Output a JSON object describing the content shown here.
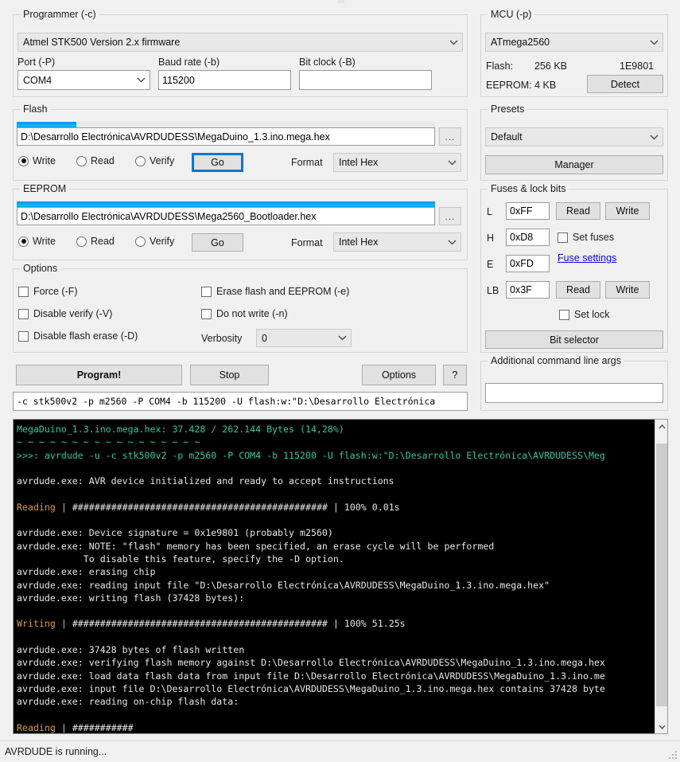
{
  "programmer": {
    "title": "Programmer (-c)",
    "selected": "Atmel STK500 Version 2.x firmware",
    "port_label": "Port (-P)",
    "port_value": "COM4",
    "baud_label": "Baud rate (-b)",
    "baud_value": "115200",
    "bitclock_label": "Bit clock (-B)",
    "bitclock_value": ""
  },
  "mcu": {
    "title": "MCU (-p)",
    "selected": "ATmega2560",
    "flash_label": "Flash:",
    "flash_value": "256 KB",
    "signature": "1E9801",
    "eeprom_label": "EEPROM: 4 KB",
    "detect_button": "Detect"
  },
  "flash": {
    "title": "Flash",
    "path": "D:\\Desarrollo Electrónica\\AVRDUDESS\\MegaDuino_1.3.ino.mega.hex",
    "browse": "...",
    "write": "Write",
    "read": "Read",
    "verify": "Verify",
    "go": "Go",
    "format_label": "Format",
    "format_value": "Intel Hex",
    "progress_percent": 14.28
  },
  "eeprom": {
    "title": "EEPROM",
    "path": "D:\\Desarrollo Electrónica\\AVRDUDESS\\Mega2560_Bootloader.hex",
    "browse": "...",
    "write": "Write",
    "read": "Read",
    "verify": "Verify",
    "go": "Go",
    "format_label": "Format",
    "format_value": "Intel Hex",
    "progress_percent": 100
  },
  "options": {
    "title": "Options",
    "force": "Force (-F)",
    "disable_verify": "Disable verify (-V)",
    "disable_flash_erase": "Disable flash erase (-D)",
    "erase_flash_eeprom": "Erase flash and EEPROM (-e)",
    "do_not_write": "Do not write (-n)",
    "verbosity_label": "Verbosity",
    "verbosity_value": "0"
  },
  "presets": {
    "title": "Presets",
    "selected": "Default",
    "manager_button": "Manager"
  },
  "fuses": {
    "title": "Fuses & lock bits",
    "l_label": "L",
    "l_value": "0xFF",
    "h_label": "H",
    "h_value": "0xD8",
    "e_label": "E",
    "e_value": "0xFD",
    "lb_label": "LB",
    "lb_value": "0x3F",
    "read_button": "Read",
    "write_button": "Write",
    "set_fuses": "Set fuses",
    "fuse_settings_link": "Fuse settings",
    "lb_read_button": "Read",
    "lb_write_button": "Write",
    "set_lock": "Set lock",
    "bit_selector_button": "Bit selector"
  },
  "actions": {
    "program": "Program!",
    "stop": "Stop",
    "options": "Options",
    "help": "?",
    "command_line": "-c stk500v2 -p m2560 -P COM4 -b 115200 -U flash:w:\"D:\\Desarrollo Electrónica"
  },
  "extra_args": {
    "title": "Additional command line args",
    "value": ""
  },
  "console": {
    "lines": [
      {
        "text": "MegaDuino_1.3.ino.mega.hex: 37.428 / 262.144 Bytes (14,28%)",
        "color": "teal"
      },
      {
        "text": "~ ~ ~ ~ ~ ~ ~ ~ ~ ~ ~ ~ ~ ~ ~ ~ ~",
        "color": "teal"
      },
      {
        "text": ">>>: avrdude -u -c stk500v2 -p m2560 -P COM4 -b 115200 -U flash:w:\"D:\\Desarrollo Electrónica\\AVRDUDESS\\Meg",
        "color": "teal"
      },
      {
        "text": "",
        "color": "white"
      },
      {
        "text": "avrdude.exe: AVR device initialized and ready to accept instructions",
        "color": "white"
      },
      {
        "text": "",
        "color": "white"
      },
      {
        "text": "Reading | ############################################## | 100% 0.01s",
        "color": "mixed-read"
      },
      {
        "text": "",
        "color": "white"
      },
      {
        "text": "avrdude.exe: Device signature = 0x1e9801 (probably m2560)",
        "color": "white"
      },
      {
        "text": "avrdude.exe: NOTE: \"flash\" memory has been specified, an erase cycle will be performed",
        "color": "white"
      },
      {
        "text": "            To disable this feature, specify the -D option.",
        "color": "white"
      },
      {
        "text": "avrdude.exe: erasing chip",
        "color": "white"
      },
      {
        "text": "avrdude.exe: reading input file \"D:\\Desarrollo Electrónica\\AVRDUDESS\\MegaDuino_1.3.ino.mega.hex\"",
        "color": "white"
      },
      {
        "text": "avrdude.exe: writing flash (37428 bytes):",
        "color": "white"
      },
      {
        "text": "",
        "color": "white"
      },
      {
        "text": "Writing | ############################################## | 100% 51.25s",
        "color": "mixed-write"
      },
      {
        "text": "",
        "color": "white"
      },
      {
        "text": "avrdude.exe: 37428 bytes of flash written",
        "color": "white"
      },
      {
        "text": "avrdude.exe: verifying flash memory against D:\\Desarrollo Electrónica\\AVRDUDESS\\MegaDuino_1.3.ino.mega.hex",
        "color": "white"
      },
      {
        "text": "avrdude.exe: load data flash data from input file D:\\Desarrollo Electrónica\\AVRDUDESS\\MegaDuino_1.3.ino.me",
        "color": "white"
      },
      {
        "text": "avrdude.exe: input file D:\\Desarrollo Electrónica\\AVRDUDESS\\MegaDuino_1.3.ino.mega.hex contains 37428 byte",
        "color": "white"
      },
      {
        "text": "avrdude.exe: reading on-chip flash data:",
        "color": "white"
      },
      {
        "text": "",
        "color": "white"
      },
      {
        "text": "Reading | ###########",
        "color": "mixed-read2"
      }
    ]
  },
  "statusbar": {
    "text": "AVRDUDE is running..."
  },
  "colors": {
    "accent": "#0078d7",
    "progress": "#14a8e8",
    "console_teal": "#31c6a5",
    "console_orange": "#d79b4a",
    "link": "#0a0aee"
  }
}
